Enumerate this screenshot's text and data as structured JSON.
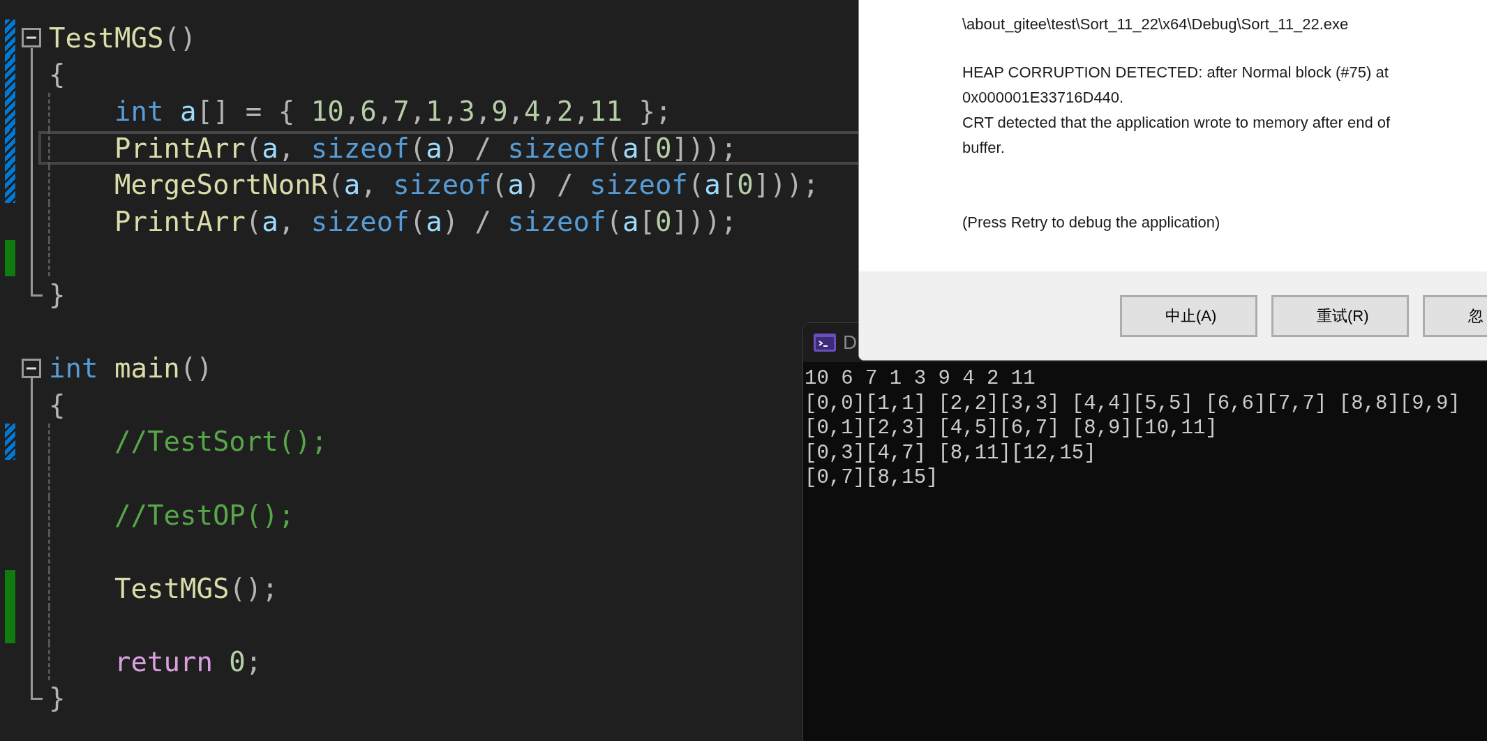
{
  "editor": {
    "blocks": [
      {
        "expanded": true,
        "lines": [
          {
            "modified": true,
            "saved": false,
            "current": false,
            "tokens": [
              {
                "text": "TestMGS",
                "kind": "function"
              },
              {
                "text": "()",
                "kind": "punct"
              }
            ]
          },
          {
            "modified": true,
            "saved": false,
            "current": false,
            "tokens": [
              {
                "text": "{",
                "kind": "punct"
              }
            ]
          },
          {
            "modified": true,
            "saved": false,
            "current": false,
            "tokens": [
              {
                "text": "int",
                "kind": "keyword"
              },
              {
                "text": " a",
                "kind": "variable"
              },
              {
                "text": "[] = { ",
                "kind": "punct"
              },
              {
                "text": "10",
                "kind": "number"
              },
              {
                "text": ",",
                "kind": "punct"
              },
              {
                "text": "6",
                "kind": "number"
              },
              {
                "text": ",",
                "kind": "punct"
              },
              {
                "text": "7",
                "kind": "number"
              },
              {
                "text": ",",
                "kind": "punct"
              },
              {
                "text": "1",
                "kind": "number"
              },
              {
                "text": ",",
                "kind": "punct"
              },
              {
                "text": "3",
                "kind": "number"
              },
              {
                "text": ",",
                "kind": "punct"
              },
              {
                "text": "9",
                "kind": "number"
              },
              {
                "text": ",",
                "kind": "punct"
              },
              {
                "text": "4",
                "kind": "number"
              },
              {
                "text": ",",
                "kind": "punct"
              },
              {
                "text": "2",
                "kind": "number"
              },
              {
                "text": ",",
                "kind": "punct"
              },
              {
                "text": "11",
                "kind": "number"
              },
              {
                "text": " };",
                "kind": "punct"
              }
            ]
          },
          {
            "modified": true,
            "saved": false,
            "current": true,
            "tokens": [
              {
                "text": "PrintArr",
                "kind": "function"
              },
              {
                "text": "(",
                "kind": "punct"
              },
              {
                "text": "a",
                "kind": "variable"
              },
              {
                "text": ", ",
                "kind": "punct"
              },
              {
                "text": "sizeof",
                "kind": "keyword"
              },
              {
                "text": "(",
                "kind": "punct"
              },
              {
                "text": "a",
                "kind": "variable"
              },
              {
                "text": ") / ",
                "kind": "punct"
              },
              {
                "text": "sizeof",
                "kind": "keyword"
              },
              {
                "text": "(",
                "kind": "punct"
              },
              {
                "text": "a",
                "kind": "variable"
              },
              {
                "text": "[",
                "kind": "punct"
              },
              {
                "text": "0",
                "kind": "number"
              },
              {
                "text": "]));",
                "kind": "punct"
              }
            ]
          },
          {
            "modified": true,
            "saved": false,
            "current": false,
            "tokens": [
              {
                "text": "MergeSortNonR",
                "kind": "function"
              },
              {
                "text": "(",
                "kind": "punct"
              },
              {
                "text": "a",
                "kind": "variable"
              },
              {
                "text": ", ",
                "kind": "punct"
              },
              {
                "text": "sizeof",
                "kind": "keyword"
              },
              {
                "text": "(",
                "kind": "punct"
              },
              {
                "text": "a",
                "kind": "variable"
              },
              {
                "text": ") / ",
                "kind": "punct"
              },
              {
                "text": "sizeof",
                "kind": "keyword"
              },
              {
                "text": "(",
                "kind": "punct"
              },
              {
                "text": "a",
                "kind": "variable"
              },
              {
                "text": "[",
                "kind": "punct"
              },
              {
                "text": "0",
                "kind": "number"
              },
              {
                "text": "]));",
                "kind": "punct"
              }
            ]
          },
          {
            "modified": false,
            "saved": false,
            "current": false,
            "tokens": [
              {
                "text": "PrintArr",
                "kind": "function"
              },
              {
                "text": "(",
                "kind": "punct"
              },
              {
                "text": "a",
                "kind": "variable"
              },
              {
                "text": ", ",
                "kind": "punct"
              },
              {
                "text": "sizeof",
                "kind": "keyword"
              },
              {
                "text": "(",
                "kind": "punct"
              },
              {
                "text": "a",
                "kind": "variable"
              },
              {
                "text": ") / ",
                "kind": "punct"
              },
              {
                "text": "sizeof",
                "kind": "keyword"
              },
              {
                "text": "(",
                "kind": "punct"
              },
              {
                "text": "a",
                "kind": "variable"
              },
              {
                "text": "[",
                "kind": "punct"
              },
              {
                "text": "0",
                "kind": "number"
              },
              {
                "text": "]));",
                "kind": "punct"
              }
            ]
          },
          {
            "modified": false,
            "saved": true,
            "current": false
          },
          {
            "modified": false,
            "saved": false,
            "current": false,
            "tokens": [
              {
                "text": "}",
                "kind": "punct"
              }
            ]
          }
        ]
      },
      {
        "expanded": true,
        "lines": [
          {
            "modified": false,
            "saved": false,
            "current": false,
            "tokens": [
              {
                "text": "int",
                "kind": "keyword"
              },
              {
                "text": " main",
                "kind": "function"
              },
              {
                "text": "()",
                "kind": "punct"
              }
            ]
          },
          {
            "modified": false,
            "saved": false,
            "current": false,
            "tokens": [
              {
                "text": "{",
                "kind": "punct"
              }
            ]
          },
          {
            "modified": true,
            "saved": false,
            "current": false,
            "tokens": [
              {
                "text": "//TestSort();",
                "kind": "comment"
              }
            ]
          },
          {
            "modified": false,
            "saved": false,
            "current": false
          },
          {
            "modified": false,
            "saved": false,
            "current": false,
            "tokens": [
              {
                "text": "//TestOP();",
                "kind": "comment"
              }
            ]
          },
          {
            "modified": false,
            "saved": false,
            "current": false
          },
          {
            "modified": false,
            "saved": true,
            "current": false,
            "tokens": [
              {
                "text": "TestMGS",
                "kind": "function"
              },
              {
                "text": "();",
                "kind": "punct"
              }
            ]
          },
          {
            "modified": false,
            "saved": true,
            "current": false
          },
          {
            "modified": false,
            "saved": false,
            "current": false,
            "tokens": [
              {
                "text": "return",
                "kind": "control"
              },
              {
                "text": " 0",
                "kind": "number"
              },
              {
                "text": ";",
                "kind": "punct"
              }
            ]
          },
          {
            "modified": false,
            "saved": false,
            "current": false,
            "tokens": [
              {
                "text": "}",
                "kind": "punct"
              }
            ]
          }
        ]
      }
    ]
  },
  "console": {
    "title": "D",
    "output": [
      "10 6 7 1 3 9 4 2 11",
      "[0,0][1,1] [2,2][3,3] [4,4][5,5] [6,6][7,7] [8,8][9,9]",
      "[0,1][2,3] [4,5][6,7] [8,9][10,11]",
      "[0,3][4,7] [8,11][12,15]",
      "[0,7][8,15]"
    ]
  },
  "dialog": {
    "paragraphs": [
      [
        "\\about_gitee\\test\\Sort_11_22\\x64\\Debug\\Sort_11_22.exe"
      ],
      [
        "HEAP CORRUPTION DETECTED: after Normal block (#75) at",
        "0x000001E33716D440.",
        "CRT detected that the application wrote to memory after end of",
        "buffer."
      ],
      [
        "(Press Retry to debug the application)"
      ]
    ],
    "buttons": [
      "中止(A)",
      "重试(R)",
      "忽"
    ]
  }
}
